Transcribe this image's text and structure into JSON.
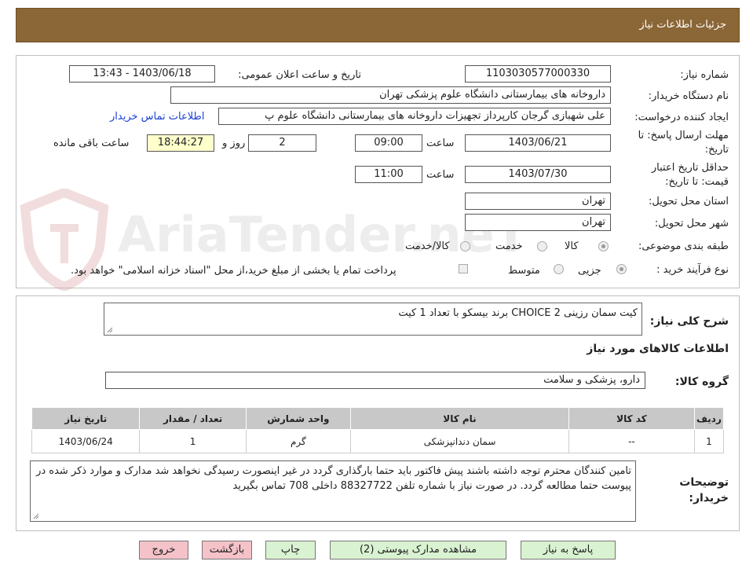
{
  "header": {
    "title": "جزئیات اطلاعات نیاز"
  },
  "watermark": {
    "text": "AriaTender.neT"
  },
  "info": {
    "need_number_label": "شماره نیاز:",
    "need_number": "1103030577000330",
    "announce_label": "تاریخ و ساعت اعلان عمومی:",
    "announce_value": "1403/06/18 - 13:43",
    "buyer_org_label": "نام دستگاه خریدار:",
    "buyer_org": "داروخانه های بیمارستانی دانشگاه علوم پزشکی تهران",
    "creator_label": "ایجاد کننده درخواست:",
    "creator": "علی شهبازی گرجان کارپرداز تجهیزات داروخانه های بیمارستانی دانشگاه علوم پ",
    "contact_link": "اطلاعات تماس خریدار",
    "deadline_label_1": "مهلت ارسال پاسخ: تا",
    "deadline_label_2": "تاریخ:",
    "deadline_date": "1403/06/21",
    "time_label": "ساعت",
    "deadline_time": "09:00",
    "days_value": "2",
    "days_label": "روز و",
    "remaining_time": "18:44:27",
    "remaining_label": "ساعت باقی مانده",
    "validity_label_1": "حداقل تاریخ اعتبار",
    "validity_label_2": "قیمت: تا تاریخ:",
    "validity_date": "1403/07/30",
    "validity_time": "11:00",
    "province_label": "استان محل تحویل:",
    "province": "تهران",
    "city_label": "شهر محل تحویل:",
    "city": "تهران",
    "category_label": "طبقه بندی موضوعی:",
    "category_options": [
      "کالا",
      "خدمت",
      "کالا/خدمت"
    ],
    "category_selected": "کالا",
    "process_label": "نوع فرآیند خرید :",
    "process_options": [
      "جزیی",
      "متوسط"
    ],
    "process_selected": "جزیی",
    "payment_note": "پرداخت تمام یا بخشی از مبلغ خرید،از محل \"اسناد خزانه اسلامی\" خواهد بود."
  },
  "details": {
    "summary_label": "شرح کلی نیاز:",
    "summary_text": "کیت سمان رزینی CHOICE 2 برند بیسکو با تعداد 1 کیت",
    "goods_info_title": "اطلاعات کالاهای مورد نیاز",
    "goods_group_label": "گروه کالا:",
    "goods_group": "دارو، پزشکی و سلامت",
    "table": {
      "headers": [
        "ردیف",
        "کد کالا",
        "نام کالا",
        "واحد شمارش",
        "تعداد / مقدار",
        "تاریخ نیاز"
      ],
      "rows": [
        [
          "1",
          "--",
          "سمان دندانپزشکی",
          "گرم",
          "1",
          "1403/06/24"
        ]
      ]
    },
    "buyer_notes_label_1": "توضیحات",
    "buyer_notes_label_2": "خریدار:",
    "buyer_notes": "تامین کنندگان محترم توجه داشته باشند پیش فاکتور باید حتما بارگذاری گردد در غیر اینصورت رسیدگی نخواهد شد مدارک و موارد ذکر شده در پیوست حتما مطالعه گردد. در صورت نیاز با شماره تلفن 88327722 داخلی 708 تماس بگیرید"
  },
  "buttons": {
    "reply": "پاسخ به نیاز",
    "attachments": "مشاهده مدارک پیوستی (2)",
    "print": "چاپ",
    "back": "بازگشت",
    "exit": "خروج"
  },
  "colors": {
    "header_bg": "#8b6636",
    "green_button": "#d9f2d1",
    "pink_button": "#f4c2c8",
    "remaining_bg": "#ffffcc",
    "link": "#1a3fd6"
  }
}
